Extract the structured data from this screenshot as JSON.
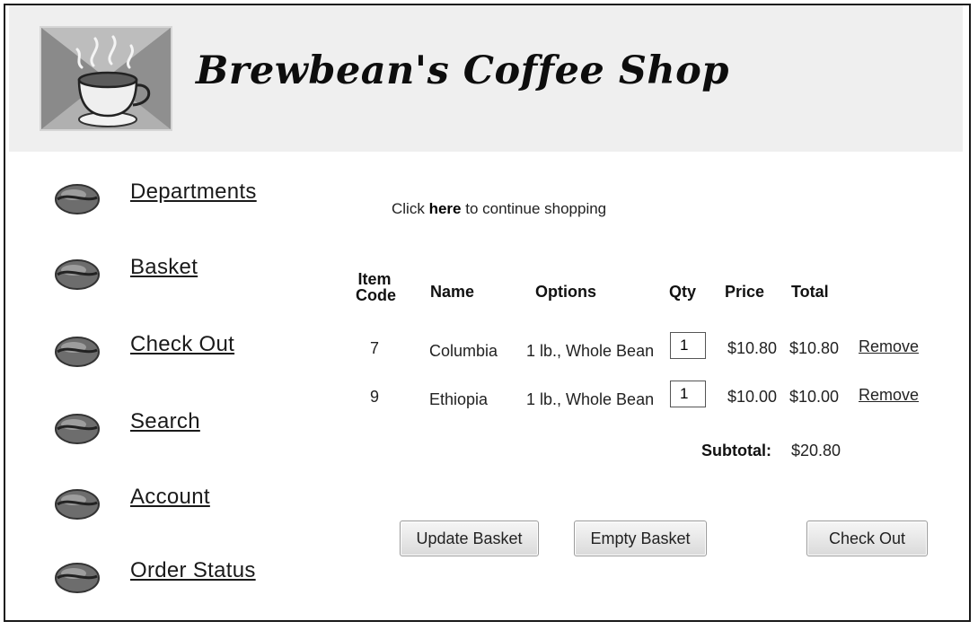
{
  "header": {
    "title": "Brewbean's Coffee Shop",
    "logo_icon": "coffee-cup-logo"
  },
  "nav": {
    "items": [
      {
        "label": "Departments",
        "icon": "coffee-bean-icon"
      },
      {
        "label": "Basket",
        "icon": "coffee-bean-icon"
      },
      {
        "label": "Check Out",
        "icon": "coffee-bean-icon"
      },
      {
        "label": "Search",
        "icon": "coffee-bean-icon"
      },
      {
        "label": "Account",
        "icon": "coffee-bean-icon"
      },
      {
        "label": "Order Status",
        "icon": "coffee-bean-icon"
      }
    ]
  },
  "basket": {
    "continue_prefix": "Click",
    "continue_link": "here",
    "continue_suffix": "to continue shopping",
    "headers": {
      "item_code_line1": "Item",
      "item_code_line2": "Code",
      "name": "Name",
      "options": "Options",
      "qty": "Qty",
      "price": "Price",
      "total": "Total"
    },
    "rows": [
      {
        "code": "7",
        "name": "Columbia",
        "options": "1 lb., Whole Bean",
        "qty": "1",
        "price": "$10.80",
        "total": "$10.80",
        "remove": "Remove"
      },
      {
        "code": "9",
        "name": "Ethiopia",
        "options": "1 lb., Whole Bean",
        "qty": "1",
        "price": "$10.00",
        "total": "$10.00",
        "remove": "Remove"
      }
    ],
    "subtotal_label": "Subtotal:",
    "subtotal_value": "$20.80",
    "buttons": {
      "update": "Update Basket",
      "empty": "Empty Basket",
      "checkout": "Check Out"
    }
  }
}
